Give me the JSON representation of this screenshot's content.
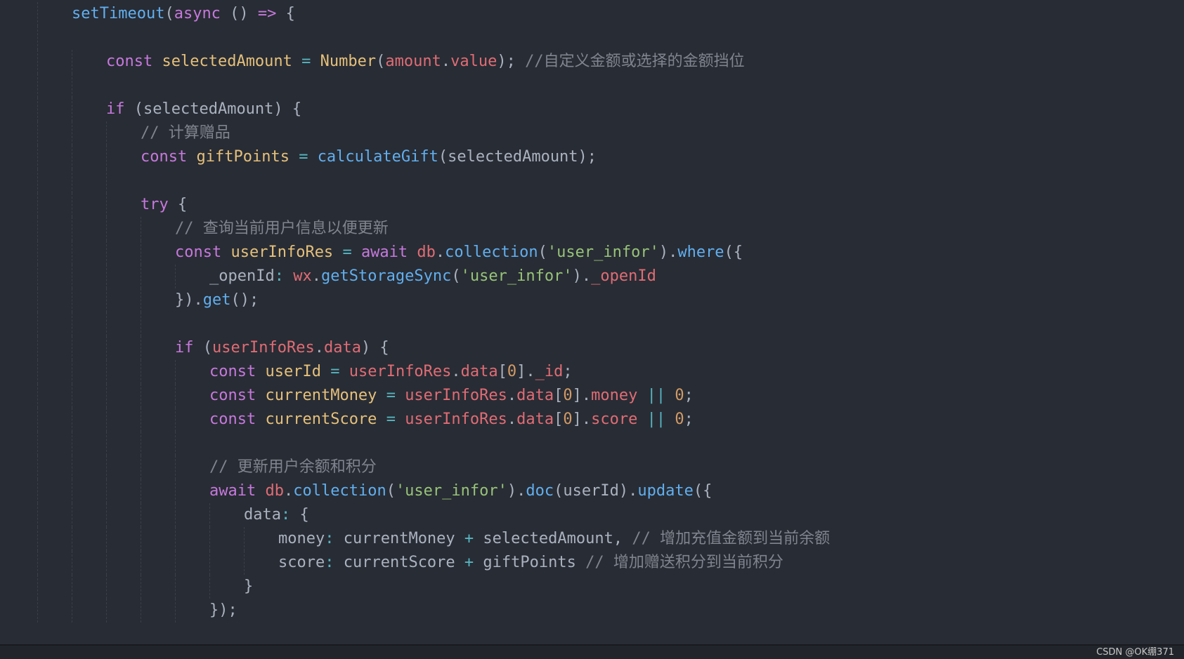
{
  "editor": {
    "lines": [
      {
        "indent": 2,
        "tokens": [
          {
            "t": "fn",
            "v": "setTimeout"
          },
          {
            "t": "pun",
            "v": "("
          },
          {
            "t": "kw",
            "v": "async"
          },
          {
            "t": "pun",
            "v": " () "
          },
          {
            "t": "kw",
            "v": "=>"
          },
          {
            "t": "pun",
            "v": " {"
          }
        ]
      },
      {
        "indent": 0,
        "tokens": []
      },
      {
        "indent": 3,
        "tokens": [
          {
            "t": "kw",
            "v": "const"
          },
          {
            "t": "plain",
            "v": " "
          },
          {
            "t": "var",
            "v": "selectedAmount"
          },
          {
            "t": "plain",
            "v": " "
          },
          {
            "t": "op",
            "v": "="
          },
          {
            "t": "plain",
            "v": " "
          },
          {
            "t": "cls",
            "v": "Number"
          },
          {
            "t": "pun",
            "v": "("
          },
          {
            "t": "prop",
            "v": "amount"
          },
          {
            "t": "pun",
            "v": "."
          },
          {
            "t": "prop",
            "v": "value"
          },
          {
            "t": "pun",
            "v": "); "
          },
          {
            "t": "com",
            "v": "//自定义金额或选择的金额挡位"
          }
        ]
      },
      {
        "indent": 0,
        "tokens": []
      },
      {
        "indent": 3,
        "tokens": [
          {
            "t": "kw",
            "v": "if"
          },
          {
            "t": "pun",
            "v": " (selectedAmount) {"
          }
        ]
      },
      {
        "indent": 4,
        "tokens": [
          {
            "t": "com",
            "v": "// 计算赠品"
          }
        ]
      },
      {
        "indent": 4,
        "tokens": [
          {
            "t": "kw",
            "v": "const"
          },
          {
            "t": "plain",
            "v": " "
          },
          {
            "t": "var",
            "v": "giftPoints"
          },
          {
            "t": "plain",
            "v": " "
          },
          {
            "t": "op",
            "v": "="
          },
          {
            "t": "plain",
            "v": " "
          },
          {
            "t": "fn",
            "v": "calculateGift"
          },
          {
            "t": "pun",
            "v": "(selectedAmount);"
          }
        ]
      },
      {
        "indent": 0,
        "tokens": []
      },
      {
        "indent": 4,
        "tokens": [
          {
            "t": "kw",
            "v": "try"
          },
          {
            "t": "pun",
            "v": " {"
          }
        ]
      },
      {
        "indent": 5,
        "tokens": [
          {
            "t": "com",
            "v": "// 查询当前用户信息以便更新"
          }
        ]
      },
      {
        "indent": 5,
        "tokens": [
          {
            "t": "kw",
            "v": "const"
          },
          {
            "t": "plain",
            "v": " "
          },
          {
            "t": "var",
            "v": "userInfoRes"
          },
          {
            "t": "plain",
            "v": " "
          },
          {
            "t": "op",
            "v": "="
          },
          {
            "t": "plain",
            "v": " "
          },
          {
            "t": "kw",
            "v": "await"
          },
          {
            "t": "plain",
            "v": " "
          },
          {
            "t": "prop",
            "v": "db"
          },
          {
            "t": "pun",
            "v": "."
          },
          {
            "t": "fn",
            "v": "collection"
          },
          {
            "t": "pun",
            "v": "("
          },
          {
            "t": "str",
            "v": "'user_infor'"
          },
          {
            "t": "pun",
            "v": ")."
          },
          {
            "t": "fn",
            "v": "where"
          },
          {
            "t": "pun",
            "v": "({"
          }
        ]
      },
      {
        "indent": 6,
        "tokens": [
          {
            "t": "plain",
            "v": "_openId"
          },
          {
            "t": "op",
            "v": ":"
          },
          {
            "t": "plain",
            "v": " "
          },
          {
            "t": "prop",
            "v": "wx"
          },
          {
            "t": "pun",
            "v": "."
          },
          {
            "t": "fn",
            "v": "getStorageSync"
          },
          {
            "t": "pun",
            "v": "("
          },
          {
            "t": "str",
            "v": "'user_infor'"
          },
          {
            "t": "pun",
            "v": ")."
          },
          {
            "t": "prop",
            "v": "_openId"
          }
        ]
      },
      {
        "indent": 5,
        "tokens": [
          {
            "t": "pun",
            "v": "})."
          },
          {
            "t": "fn",
            "v": "get"
          },
          {
            "t": "pun",
            "v": "();"
          }
        ]
      },
      {
        "indent": 0,
        "tokens": []
      },
      {
        "indent": 5,
        "tokens": [
          {
            "t": "kw",
            "v": "if"
          },
          {
            "t": "pun",
            "v": " ("
          },
          {
            "t": "prop",
            "v": "userInfoRes"
          },
          {
            "t": "pun",
            "v": "."
          },
          {
            "t": "prop",
            "v": "data"
          },
          {
            "t": "pun",
            "v": ") {"
          }
        ]
      },
      {
        "indent": 6,
        "tokens": [
          {
            "t": "kw",
            "v": "const"
          },
          {
            "t": "plain",
            "v": " "
          },
          {
            "t": "var",
            "v": "userId"
          },
          {
            "t": "plain",
            "v": " "
          },
          {
            "t": "op",
            "v": "="
          },
          {
            "t": "plain",
            "v": " "
          },
          {
            "t": "prop",
            "v": "userInfoRes"
          },
          {
            "t": "pun",
            "v": "."
          },
          {
            "t": "prop",
            "v": "data"
          },
          {
            "t": "pun",
            "v": "["
          },
          {
            "t": "num",
            "v": "0"
          },
          {
            "t": "pun",
            "v": "]."
          },
          {
            "t": "prop",
            "v": "_id"
          },
          {
            "t": "pun",
            "v": ";"
          }
        ]
      },
      {
        "indent": 6,
        "tokens": [
          {
            "t": "kw",
            "v": "const"
          },
          {
            "t": "plain",
            "v": " "
          },
          {
            "t": "var",
            "v": "currentMoney"
          },
          {
            "t": "plain",
            "v": " "
          },
          {
            "t": "op",
            "v": "="
          },
          {
            "t": "plain",
            "v": " "
          },
          {
            "t": "prop",
            "v": "userInfoRes"
          },
          {
            "t": "pun",
            "v": "."
          },
          {
            "t": "prop",
            "v": "data"
          },
          {
            "t": "pun",
            "v": "["
          },
          {
            "t": "num",
            "v": "0"
          },
          {
            "t": "pun",
            "v": "]."
          },
          {
            "t": "prop",
            "v": "money"
          },
          {
            "t": "plain",
            "v": " "
          },
          {
            "t": "op",
            "v": "||"
          },
          {
            "t": "plain",
            "v": " "
          },
          {
            "t": "num",
            "v": "0"
          },
          {
            "t": "pun",
            "v": ";"
          }
        ]
      },
      {
        "indent": 6,
        "tokens": [
          {
            "t": "kw",
            "v": "const"
          },
          {
            "t": "plain",
            "v": " "
          },
          {
            "t": "var",
            "v": "currentScore"
          },
          {
            "t": "plain",
            "v": " "
          },
          {
            "t": "op",
            "v": "="
          },
          {
            "t": "plain",
            "v": " "
          },
          {
            "t": "prop",
            "v": "userInfoRes"
          },
          {
            "t": "pun",
            "v": "."
          },
          {
            "t": "prop",
            "v": "data"
          },
          {
            "t": "pun",
            "v": "["
          },
          {
            "t": "num",
            "v": "0"
          },
          {
            "t": "pun",
            "v": "]."
          },
          {
            "t": "prop",
            "v": "score"
          },
          {
            "t": "plain",
            "v": " "
          },
          {
            "t": "op",
            "v": "||"
          },
          {
            "t": "plain",
            "v": " "
          },
          {
            "t": "num",
            "v": "0"
          },
          {
            "t": "pun",
            "v": ";"
          }
        ]
      },
      {
        "indent": 0,
        "tokens": []
      },
      {
        "indent": 6,
        "tokens": [
          {
            "t": "com",
            "v": "// 更新用户余额和积分"
          }
        ]
      },
      {
        "indent": 6,
        "tokens": [
          {
            "t": "kw",
            "v": "await"
          },
          {
            "t": "plain",
            "v": " "
          },
          {
            "t": "prop",
            "v": "db"
          },
          {
            "t": "pun",
            "v": "."
          },
          {
            "t": "fn",
            "v": "collection"
          },
          {
            "t": "pun",
            "v": "("
          },
          {
            "t": "str",
            "v": "'user_infor'"
          },
          {
            "t": "pun",
            "v": ")."
          },
          {
            "t": "fn",
            "v": "doc"
          },
          {
            "t": "pun",
            "v": "(userId)."
          },
          {
            "t": "fn",
            "v": "update"
          },
          {
            "t": "pun",
            "v": "({"
          }
        ]
      },
      {
        "indent": 7,
        "tokens": [
          {
            "t": "plain",
            "v": "data"
          },
          {
            "t": "op",
            "v": ":"
          },
          {
            "t": "pun",
            "v": " {"
          }
        ]
      },
      {
        "indent": 8,
        "tokens": [
          {
            "t": "plain",
            "v": "money"
          },
          {
            "t": "op",
            "v": ":"
          },
          {
            "t": "plain",
            "v": " currentMoney "
          },
          {
            "t": "op",
            "v": "+"
          },
          {
            "t": "plain",
            "v": " selectedAmount, "
          },
          {
            "t": "com",
            "v": "// 增加充值金额到当前余额"
          }
        ]
      },
      {
        "indent": 8,
        "tokens": [
          {
            "t": "plain",
            "v": "score"
          },
          {
            "t": "op",
            "v": ":"
          },
          {
            "t": "plain",
            "v": " currentScore "
          },
          {
            "t": "op",
            "v": "+"
          },
          {
            "t": "plain",
            "v": " giftPoints "
          },
          {
            "t": "com",
            "v": "// 增加赠送积分到当前积分"
          }
        ]
      },
      {
        "indent": 7,
        "tokens": [
          {
            "t": "pun",
            "v": "}"
          }
        ]
      },
      {
        "indent": 6,
        "tokens": [
          {
            "t": "pun",
            "v": "});"
          }
        ]
      }
    ]
  },
  "watermark": "CSDN @OK绷371",
  "colors": {
    "background": "#282c34",
    "keyword": "#c678dd",
    "function": "#61afef",
    "variable": "#e5c07b",
    "property": "#e06c75",
    "string": "#98c379",
    "number": "#d19a66",
    "operator": "#56b6c2",
    "comment": "#7f848e",
    "plain": "#abb2bf"
  }
}
